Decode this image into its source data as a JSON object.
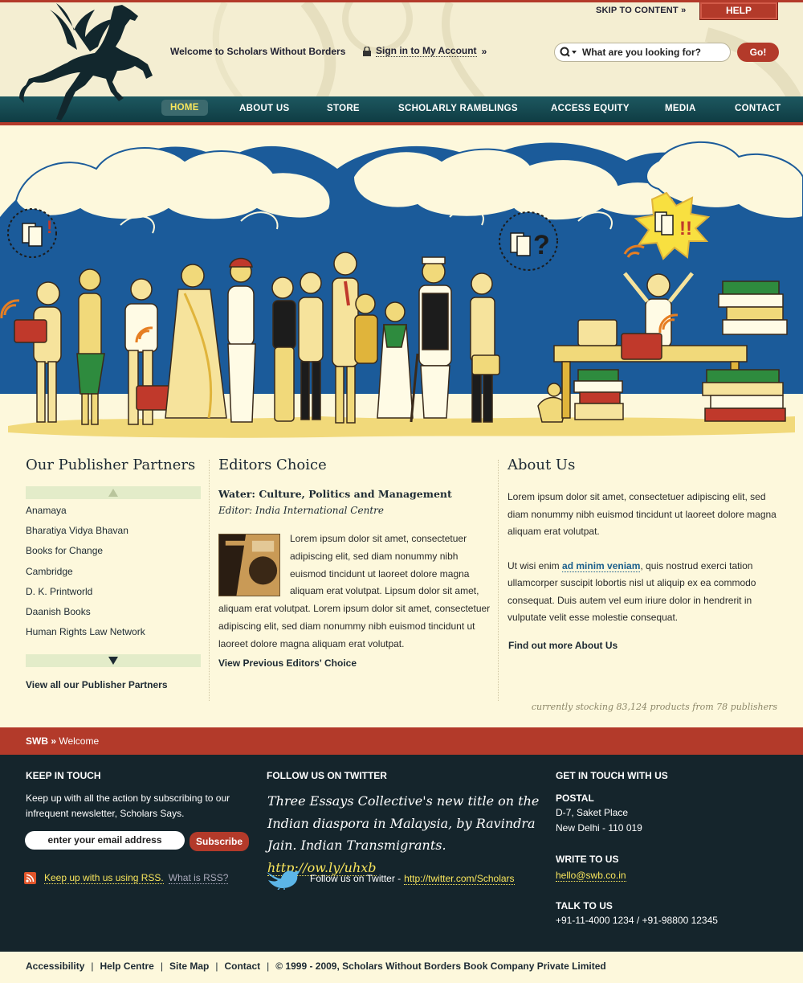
{
  "header": {
    "welcome": "Welcome to Scholars Without Borders",
    "signin": "Sign in to My Account",
    "signin_arrow": "»",
    "skip": "SKIP TO CONTENT",
    "skip_arrow": "»",
    "help": "HELP",
    "search_placeholder": "What are you looking for?",
    "go": "Go!"
  },
  "nav": {
    "items": [
      "HOME",
      "ABOUT US",
      "STORE",
      "SCHOLARLY RAMBLINGS",
      "ACCESS EQUITY",
      "MEDIA",
      "CONTACT"
    ]
  },
  "publishers": {
    "title": "Our Publisher Partners",
    "items": [
      "Anamaya",
      "Bharatiya Vidya Bhavan",
      "Books for Change",
      "Cambridge",
      "D. K. Printworld",
      "Daanish Books",
      "Human Rights Law Network"
    ],
    "view_all": "View all our Publisher Partners"
  },
  "editors": {
    "title": "Editors Choice",
    "book_title": "Water: Culture, Politics and Management",
    "editor": "Editor: India International Centre",
    "body": "Lorem ipsum dolor sit amet, consectetuer adipiscing elit, sed diam nonummy nibh euismod tincidunt ut laoreet dolore magna aliquam erat volutpat. Lipsum dolor sit amet, aliquam erat volutpat. Lorem ipsum dolor sit amet, consectetuer adipiscing elit, sed diam nonummy nibh euismod tincidunt ut laoreet dolore magna aliquam erat volutpat.",
    "previous": "View Previous Editors' Choice"
  },
  "about": {
    "title": "About Us",
    "p1": "Lorem ipsum dolor sit amet, consectetuer adipiscing elit, sed diam nonummy nibh euismod tincidunt ut laoreet dolore magna aliquam erat volutpat.",
    "p2_start": "Ut wisi enim ",
    "p2_link": "ad minim veniam",
    "p2_end": ", quis nostrud exerci tation ullamcorper suscipit lobortis nisl ut aliquip ex ea commodo consequat. Duis autem vel eum iriure dolor in hendrerit in vulputate velit esse molestie consequat.",
    "more": "Find out more About Us"
  },
  "stocking": "currently stocking 83,124 products from 78 publishers",
  "breadcrumb": {
    "home": "SWB",
    "sep": " » ",
    "current": "Welcome"
  },
  "footer": {
    "keep_title": "KEEP IN TOUCH",
    "keep_text": "Keep up with all the action by subscribing to our infrequent newsletter, Scholars Says.",
    "email_placeholder": "enter your email address",
    "subscribe": "Subscribe",
    "rss_text": "Keep up with us using RSS.",
    "rss_what": "What is RSS?",
    "twitter_title": "FOLLOW US ON TWITTER",
    "tweet_text": "Three Essays Collective's new title on the Indian diaspora in Malaysia, by Ravindra Jain. Indian Transmigrants. ",
    "tweet_link": "http://ow.ly/uhxb",
    "follow_text": "Follow us on Twitter - ",
    "follow_link": "http://twitter.com/Scholars",
    "contact_title": "GET IN TOUCH WITH US",
    "postal_title": "POSTAL",
    "postal_line1": "D-7, Saket Place",
    "postal_line2": "New Delhi - 110 019",
    "write_title": "WRITE TO US",
    "email": "hello@swb.co.in",
    "talk_title": "TALK TO US",
    "phone": "+91-11-4000 1234 / +91-98800 12345"
  },
  "bottom": {
    "links": [
      "Accessibility",
      "Help Centre",
      "Site Map",
      "Contact"
    ],
    "copyright": "© 1999 - 2009, Scholars Without Borders Book Company Private Limited"
  },
  "colors": {
    "accent": "#b33a2a",
    "nav": "#134650",
    "footer": "#15252c",
    "background": "#fdf8dc",
    "sky": "#1b5b9a",
    "link": "#f8e55c"
  }
}
